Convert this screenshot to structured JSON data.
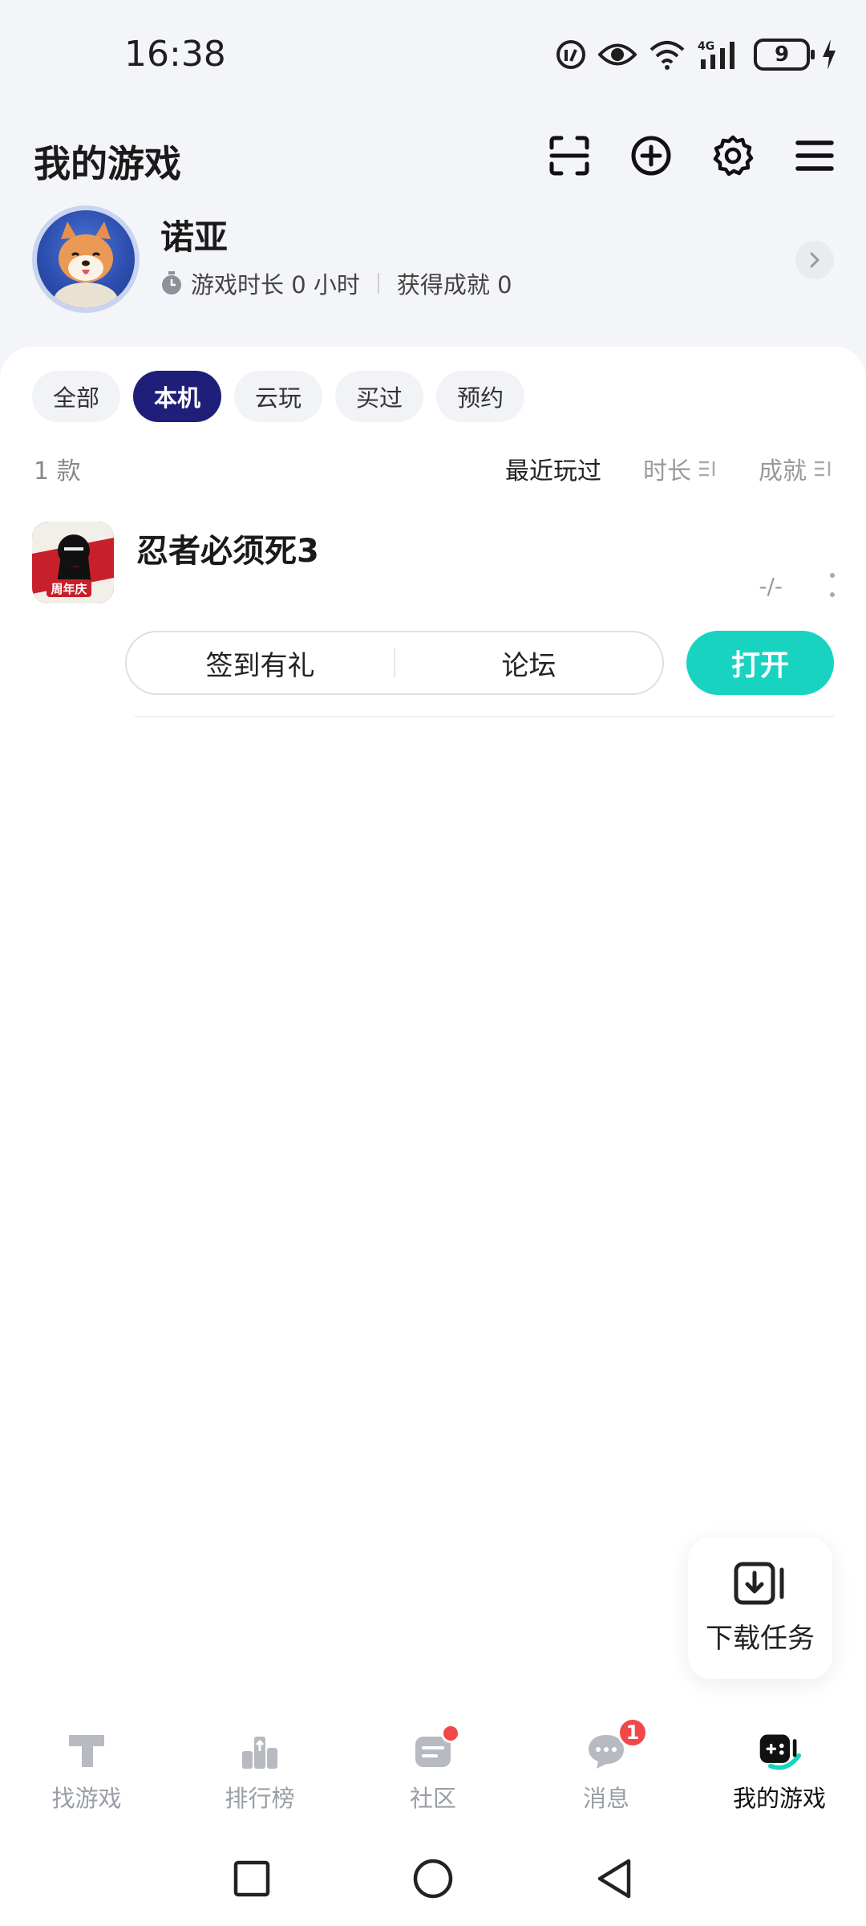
{
  "status_bar": {
    "time": "16:38",
    "battery": "9"
  },
  "header": {
    "title": "我的游戏"
  },
  "profile": {
    "name": "诺亚",
    "playtime_label": "游戏时长 0 小时",
    "achievements_label": "获得成就 0"
  },
  "filters": [
    "全部",
    "本机",
    "云玩",
    "买过",
    "预约"
  ],
  "active_filter": "本机",
  "list": {
    "count": "1 款",
    "sort_recent": "最近玩过",
    "sort_duration": "时长",
    "sort_achievement": "成就"
  },
  "game": {
    "name": "忍者必须死3",
    "stat": "-/-",
    "icon_badge": "周年庆",
    "checkin_label": "签到有礼",
    "forum_label": "论坛",
    "open_label": "打开"
  },
  "download_task": {
    "label": "下载任务"
  },
  "bottom_nav": {
    "items": [
      {
        "label": "找游戏",
        "icon": "find-games-icon"
      },
      {
        "label": "排行榜",
        "icon": "ranking-icon"
      },
      {
        "label": "社区",
        "icon": "community-icon"
      },
      {
        "label": "消息",
        "icon": "message-icon",
        "badge": "1"
      },
      {
        "label": "我的游戏",
        "icon": "my-games-icon"
      }
    ]
  },
  "colors": {
    "accent": "#19d3c1",
    "active_chip": "#1f1f7a",
    "badge": "#f04848"
  }
}
